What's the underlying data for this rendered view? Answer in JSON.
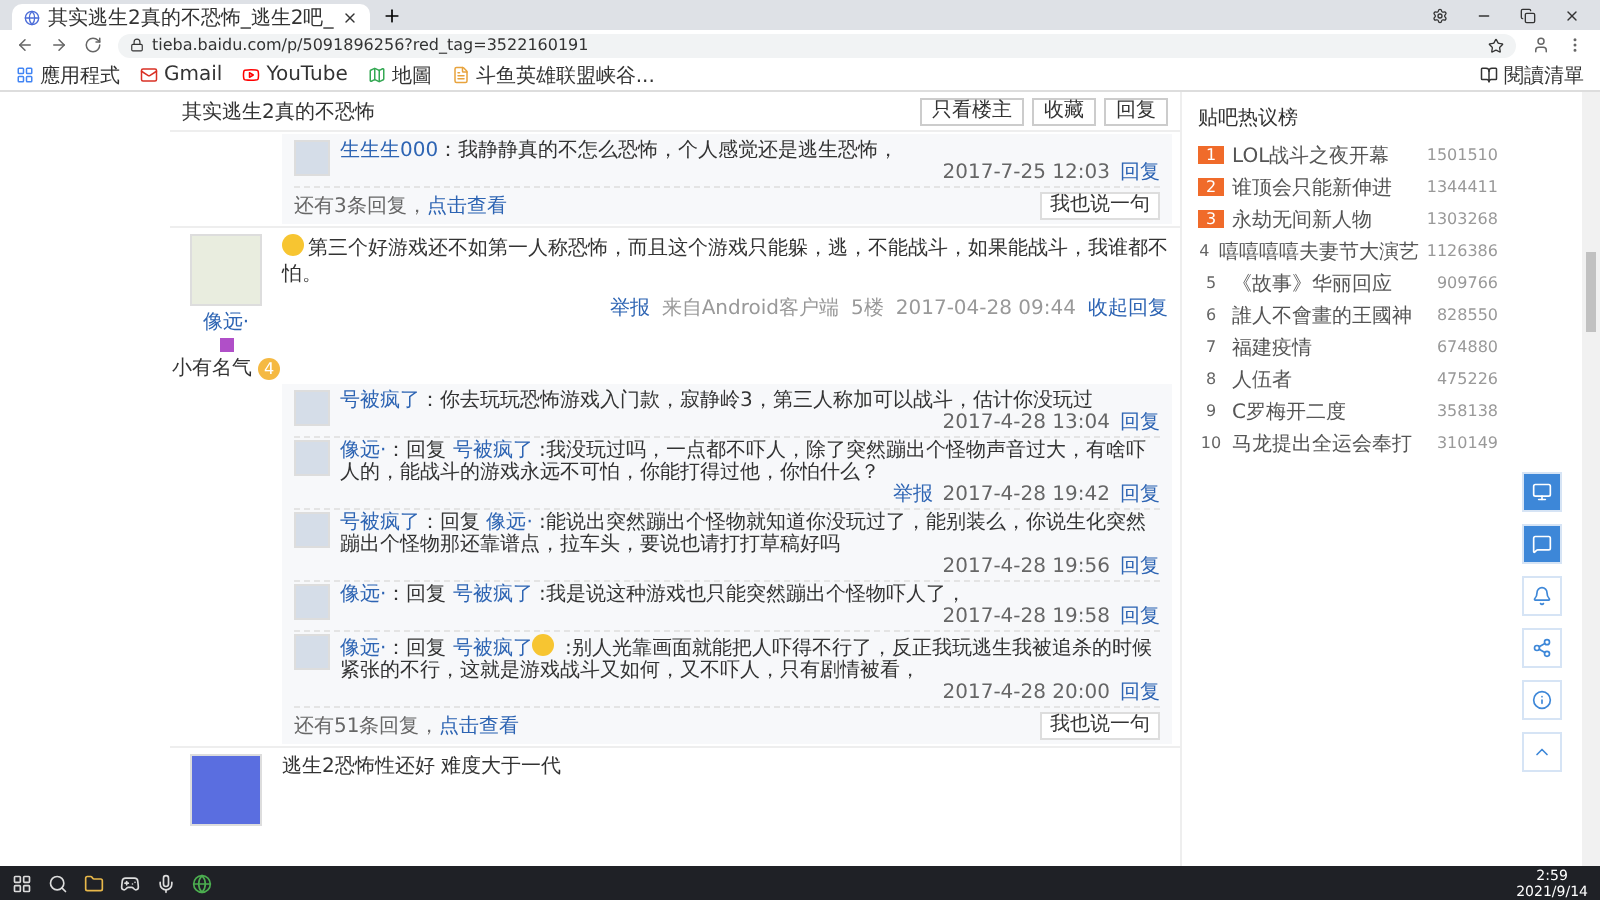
{
  "browser": {
    "tab_title": "其实逃生2真的不恐怖_逃生2吧_",
    "url": "tieba.baidu.com/p/5091896256?red_tag=3522160191",
    "bookmarks": [
      {
        "label": "應用程式",
        "kind": "apps"
      },
      {
        "label": "Gmail",
        "kind": "mail"
      },
      {
        "label": "YouTube",
        "kind": "video"
      },
      {
        "label": "地圖",
        "kind": "map"
      },
      {
        "label": "斗鱼英雄联盟峡谷...",
        "kind": "page"
      }
    ],
    "reading_list": "閱讀清單"
  },
  "thread": {
    "title": "其实逃生2真的不恐怖",
    "actions": [
      "只看楼主",
      "收藏",
      "回复"
    ]
  },
  "prev_tail": {
    "replies": [
      {
        "user": "生生生000",
        "text": "：我静静真的不怎么恐怖，个人感觉还是逃生恐怖，",
        "time": "2017-7-25 12:03",
        "action": "回复"
      }
    ],
    "more": "还有3条回复，",
    "more_link": "点击查看",
    "reply_button": "我也说一句"
  },
  "post": {
    "user": "像远·",
    "level_title": "小有名气",
    "level": "4",
    "text": "第三个好游戏还不如第一人称恐怖，而且这个游戏只能躲，逃，不能战斗，如果能战斗，我谁都不怕。",
    "emoji": true,
    "footer": {
      "report": "举报",
      "client": "来自Android客户端",
      "floor": "5楼",
      "time": "2017-04-28 09:44",
      "toggle": "收起回复"
    },
    "replies": [
      {
        "user": "号被疯了",
        "text": "：你去玩玩恐怖游戏入门款，寂静岭3，第三人称加可以战斗，估计你没玩过",
        "time": "2017-4-28 13:04",
        "action": "回复"
      },
      {
        "user": "像远·",
        "prefix": "：回复 ",
        "reply_to": "号被疯了",
        "text": " :我没玩过吗，一点都不吓人，除了突然蹦出个怪物声音过大，有啥吓人的，能战斗的游戏永远不可怕，你能打得过他，你怕什么？",
        "report": "举报",
        "time": "2017-4-28 19:42",
        "action": "回复"
      },
      {
        "user": "号被疯了",
        "prefix": "：回复 ",
        "reply_to": "像远·",
        "text": " :能说出突然蹦出个怪物就知道你没玩过了，能别装么，你说生化突然蹦出个怪物那还靠谱点，拉车头，要说也请打打草稿好吗",
        "time": "2017-4-28 19:56",
        "action": "回复"
      },
      {
        "user": "像远·",
        "prefix": "：回复 ",
        "reply_to": "号被疯了",
        "text": " :我是说这种游戏也只能突然蹦出个怪物吓人了，",
        "time": "2017-4-28 19:58",
        "action": "回复"
      },
      {
        "user": "像远·",
        "prefix": "：回复 ",
        "reply_to": "号被疯了",
        "text": " :别人光靠画面就能把人吓得不行了，反正我玩逃生我被追杀的时候紧张的不行，这就是游戏战斗又如何，又不吓人，只有剧情被看，",
        "emoji": true,
        "time": "2017-4-28 20:00",
        "action": "回复"
      }
    ],
    "more": "还有51条回复，",
    "more_link": "点击查看",
    "reply_button": "我也说一句"
  },
  "next_post": {
    "text": "逃生2恐怖性还好 难度大于一代"
  },
  "hot_list": {
    "title": "贴吧热议榜",
    "items": [
      {
        "rank": "1",
        "title": "LOL战斗之夜开幕",
        "count": "1501510",
        "hot": true
      },
      {
        "rank": "2",
        "title": "谁顶会只能新伸进",
        "count": "1344411",
        "hot": true
      },
      {
        "rank": "3",
        "title": "永劫无间新人物",
        "count": "1303268",
        "hot": true
      },
      {
        "rank": "4",
        "title": "嘻嘻嘻嘻夫妻节大演艺",
        "count": "1126386",
        "hot": false
      },
      {
        "rank": "5",
        "title": "《故事》华丽回应",
        "count": "909766",
        "hot": false
      },
      {
        "rank": "6",
        "title": "誰人不會畫的王國神",
        "count": "828550",
        "hot": false
      },
      {
        "rank": "7",
        "title": "福建疫情",
        "count": "674880",
        "hot": false
      },
      {
        "rank": "8",
        "title": "人伍者",
        "count": "475226",
        "hot": false
      },
      {
        "rank": "9",
        "title": "C罗梅开二度",
        "count": "358138",
        "hot": false
      },
      {
        "rank": "10",
        "title": "马龙提出全运会奉打",
        "count": "310149",
        "hot": false
      }
    ]
  },
  "taskbar": {
    "time": "2:59",
    "date": "2021/9/14"
  }
}
